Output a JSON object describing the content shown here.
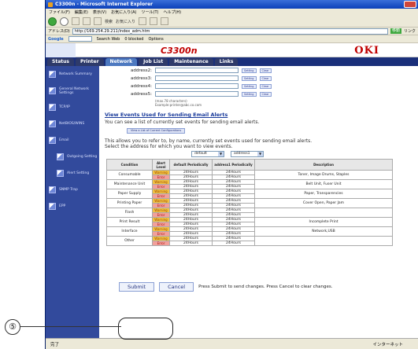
{
  "window": {
    "title": "C3300n - Microsoft Internet Explorer"
  },
  "menu": [
    "ファイル(F)",
    "編集(E)",
    "表示(V)",
    "お気に入り(A)",
    "ツール(T)",
    "ヘルプ(H)"
  ],
  "nav": {
    "search_label": "検索",
    "favorites_label": "お気に入り"
  },
  "address": {
    "label": "アドレス(D)",
    "url": "http://169.254.29.211/index_adm.htm",
    "go": "移動",
    "links": "リンク"
  },
  "google": {
    "logo": "Google",
    "search_web": "Search Web",
    "blocked": "0 blocked",
    "options": "Options"
  },
  "header": {
    "model": "C3300n",
    "brand": "OKI"
  },
  "tabs": [
    "Status",
    "Printer",
    "Network",
    "Job List",
    "Maintenance",
    "Links"
  ],
  "sidebar": [
    "Network Summary",
    "General Network Settings",
    "TCP/IP",
    "NetBIOS/WINS",
    "Email",
    "Outgoing Setting",
    "Alert Setting",
    "SNMP Trap",
    "EPP"
  ],
  "addresses": [
    {
      "label": "address2:"
    },
    {
      "label": "address3:"
    },
    {
      "label": "address4:"
    },
    {
      "label": "address5:"
    }
  ],
  "buttons": {
    "setting": "Setting",
    "clear": "Clear"
  },
  "note1": "(max.78 characters)",
  "note2": "Example:printer@abc.co.com",
  "events": {
    "heading": "View Events Used for Sending Email Alerts",
    "para1": "You can see a list of currently set events for sending email alerts.",
    "view_btn": "View a List of Current Configurations",
    "para2": "This allows you to refer to, by name, currently set events used for sending email alerts.",
    "para3": "Select the address for which you want to view events.",
    "sel1": "default",
    "sel2": "address1"
  },
  "table": {
    "headers": [
      "Condition",
      "Alert Level",
      "default Periodically",
      "address1 Periodically",
      "Description"
    ],
    "rows": [
      {
        "cond": "Consumable",
        "desc": "Toner, Image Drums, Staples"
      },
      {
        "cond": "Maintenance Unit",
        "desc": "Belt Unit, Fuser Unit"
      },
      {
        "cond": "Paper Supply",
        "desc": "Paper, Transparencies"
      },
      {
        "cond": "Printing Paper",
        "desc": "Cover Open, Paper Jam"
      },
      {
        "cond": "Flash",
        "desc": ""
      },
      {
        "cond": "Print Result",
        "desc": "Incomplete Print"
      },
      {
        "cond": "Interface",
        "desc": "Network,USB"
      },
      {
        "cond": "Other",
        "desc": ""
      }
    ],
    "warning": "Warning",
    "error": "Error",
    "period": "24Hours"
  },
  "footer": {
    "submit": "Submit",
    "cancel": "Cancel",
    "text": "Press Submit to send changes. Press Cancel to clear changes."
  },
  "status": {
    "left": "完了",
    "right": "インターネット"
  },
  "marker": "⑤"
}
